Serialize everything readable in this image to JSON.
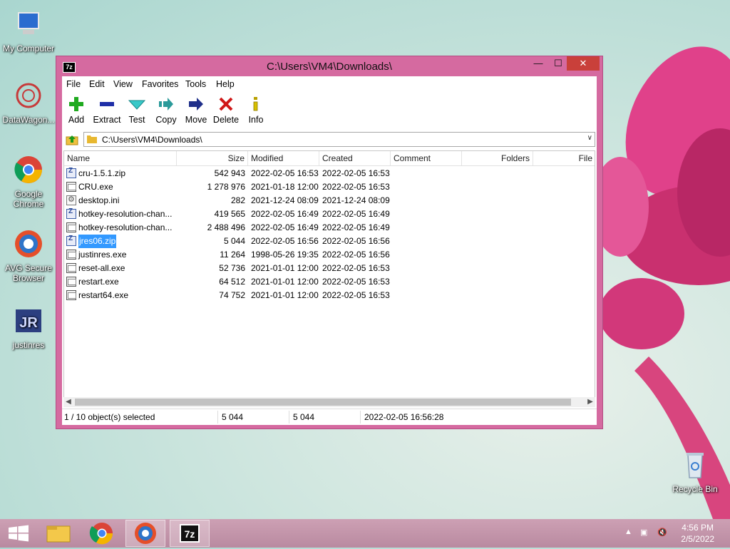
{
  "desktop": {
    "icons": [
      {
        "label": "My Computer"
      },
      {
        "label": "DataWagon..."
      },
      {
        "label": "Google Chrome"
      },
      {
        "label": "AVG Secure Browser"
      },
      {
        "label": "justinres"
      },
      {
        "label": "Recycle Bin"
      }
    ]
  },
  "window": {
    "title": "C:\\Users\\VM4\\Downloads\\",
    "app_icon": "7z",
    "buttons": {
      "minimize": "—",
      "maximize": "☐",
      "close": "✕"
    }
  },
  "menu": [
    "File",
    "Edit",
    "View",
    "Favorites",
    "Tools",
    "Help"
  ],
  "toolbar": [
    {
      "label": "Add",
      "icon": "plus-icon"
    },
    {
      "label": "Extract",
      "icon": "minus-icon"
    },
    {
      "label": "Test",
      "icon": "check-icon"
    },
    {
      "label": "Copy",
      "icon": "copy-arrow-icon"
    },
    {
      "label": "Move",
      "icon": "move-arrow-icon"
    },
    {
      "label": "Delete",
      "icon": "delete-x-icon"
    },
    {
      "label": "Info",
      "icon": "info-icon"
    }
  ],
  "address": {
    "path": "C:\\Users\\VM4\\Downloads\\"
  },
  "columns": [
    "Name",
    "Size",
    "Modified",
    "Created",
    "Comment",
    "Folders",
    "File"
  ],
  "files": [
    {
      "name": "cru-1.5.1.zip",
      "type": "zip",
      "size": "542 943",
      "modified": "2022-02-05 16:53",
      "created": "2022-02-05 16:53"
    },
    {
      "name": "CRU.exe",
      "type": "exe",
      "size": "1 278 976",
      "modified": "2021-01-18 12:00",
      "created": "2022-02-05 16:53"
    },
    {
      "name": "desktop.ini",
      "type": "ini",
      "size": "282",
      "modified": "2021-12-24 08:09",
      "created": "2021-12-24 08:09"
    },
    {
      "name": "hotkey-resolution-chan...",
      "type": "zip",
      "size": "419 565",
      "modified": "2022-02-05 16:49",
      "created": "2022-02-05 16:49"
    },
    {
      "name": "hotkey-resolution-chan...",
      "type": "exe",
      "size": "2 488 496",
      "modified": "2022-02-05 16:49",
      "created": "2022-02-05 16:49"
    },
    {
      "name": "jres06.zip",
      "type": "zip",
      "size": "5 044",
      "modified": "2022-02-05 16:56",
      "created": "2022-02-05 16:56",
      "selected": true
    },
    {
      "name": "justinres.exe",
      "type": "exe",
      "size": "11 264",
      "modified": "1998-05-26 19:35",
      "created": "2022-02-05 16:56"
    },
    {
      "name": "reset-all.exe",
      "type": "exe",
      "size": "52 736",
      "modified": "2021-01-01 12:00",
      "created": "2022-02-05 16:53"
    },
    {
      "name": "restart.exe",
      "type": "exe",
      "size": "64 512",
      "modified": "2021-01-01 12:00",
      "created": "2022-02-05 16:53"
    },
    {
      "name": "restart64.exe",
      "type": "exe",
      "size": "74 752",
      "modified": "2021-01-01 12:00",
      "created": "2022-02-05 16:53"
    }
  ],
  "status": {
    "selection": "1 / 10 object(s) selected",
    "size": "5 044",
    "packed": "5 044",
    "modified": "2022-02-05 16:56:28"
  },
  "taskbar": {
    "time": "4:56 PM",
    "date": "2/5/2022",
    "apps": [
      "start-icon",
      "file-explorer-icon",
      "chrome-icon",
      "avg-browser-icon",
      "7zip-icon"
    ]
  }
}
